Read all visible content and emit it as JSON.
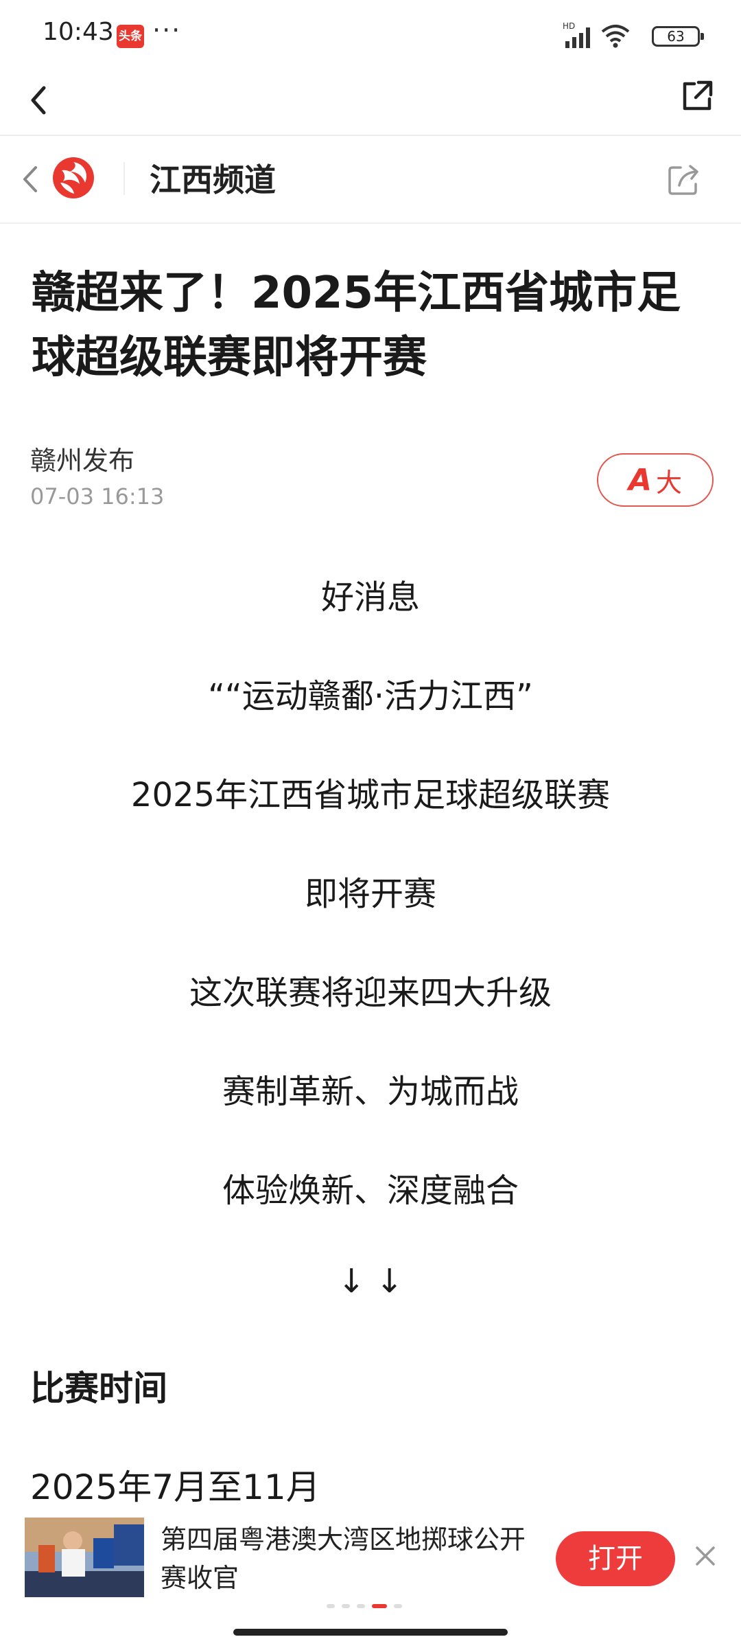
{
  "status_bar": {
    "time": "10:43",
    "app_badge": "头条",
    "more": "···",
    "battery": "63",
    "network_label": "HD"
  },
  "channel": {
    "title": "江西频道"
  },
  "article": {
    "title": "赣超来了！2025年江西省城市足球超级联赛即将开赛",
    "source": "赣州发布",
    "time": "07-03 16:13",
    "font_button_label": "大",
    "font_button_icon": "A",
    "paragraphs": [
      "好消息",
      "““运动赣鄱·活力江西”",
      "2025年江西省城市足球超级联赛",
      "即将开赛",
      "这次联赛将迎来四大升级",
      "赛制革新、为城而战",
      "体验焕新、深度融合",
      "↓ ↓"
    ],
    "section_heading": "比赛时间",
    "date": "2025年7月至11月"
  },
  "promo": {
    "text": "第四届粤港澳大湾区地掷球公开赛收官",
    "open_label": "打开"
  },
  "colors": {
    "accent": "#e8382f",
    "open_button": "#ee3b3b"
  }
}
